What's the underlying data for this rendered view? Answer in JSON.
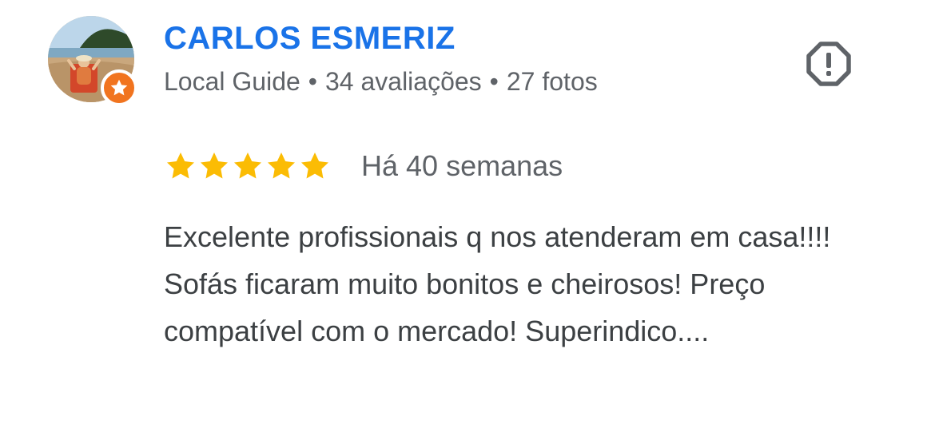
{
  "review": {
    "author": {
      "name": "CARLOS ESMERIZ",
      "badge": "Local Guide",
      "reviews_count": "34 avaliações",
      "photos_count": "27 fotos",
      "separator": "•",
      "avatar_icon": "avatar-photo-beach-chair",
      "badge_icon": "local-guide-star-icon"
    },
    "report_icon": "report-octagon-exclamation-icon",
    "rating": 5,
    "rating_max": 5,
    "date": "Há 40 semanas",
    "text": "Excelente profissionais q nos atenderam em casa!!!! Sofás ficaram muito bonitos e cheirosos! Preço compatível com o mercado! Superindico...."
  },
  "colors": {
    "name": "#1a73e8",
    "meta": "#5f6368",
    "body_text": "#3c4043",
    "star": "#fbbc04",
    "badge": "#f1741f",
    "report_icon": "#5f6368"
  }
}
